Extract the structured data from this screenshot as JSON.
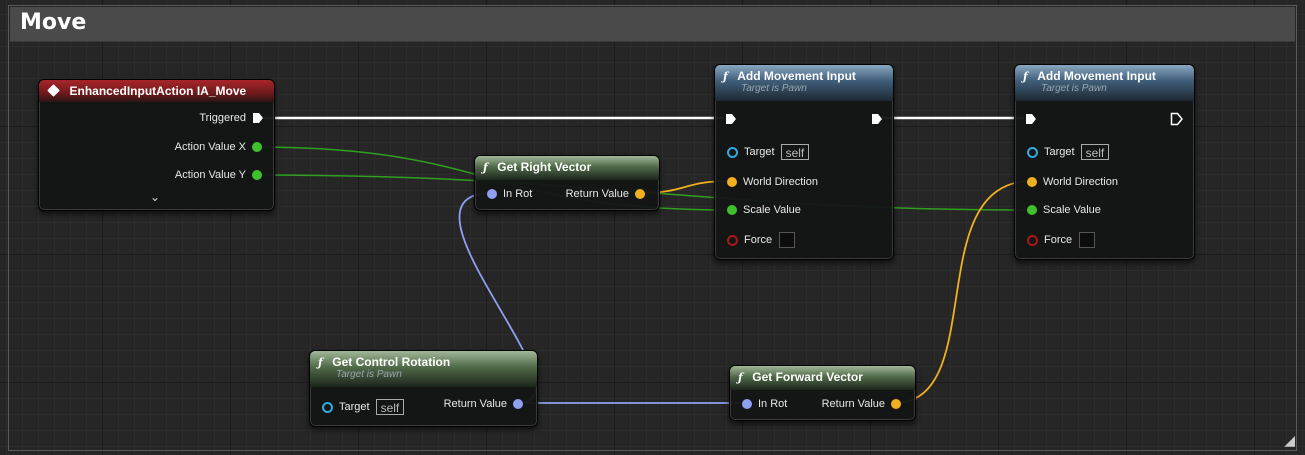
{
  "comment": {
    "title": "Move"
  },
  "nodes": {
    "event": {
      "title": "EnhancedInputAction IA_Move",
      "pins": {
        "triggered": "Triggered",
        "action_x": "Action Value X",
        "action_y": "Action Value Y"
      },
      "expand_icon": "chevron-down-icon"
    },
    "right_vector": {
      "title": "Get Right Vector",
      "pins": {
        "in_rot": "In Rot",
        "return": "Return Value"
      }
    },
    "control_rotation": {
      "title": "Get Control Rotation",
      "subtitle": "Target is Pawn",
      "pins": {
        "target": "Target",
        "target_value": "self",
        "return": "Return Value"
      }
    },
    "forward_vector": {
      "title": "Get Forward Vector",
      "pins": {
        "in_rot": "In Rot",
        "return": "Return Value"
      }
    },
    "add_movement_1": {
      "title": "Add Movement Input",
      "subtitle": "Target is Pawn",
      "pins": {
        "target": "Target",
        "target_value": "self",
        "world_direction": "World Direction",
        "scale_value": "Scale Value",
        "force": "Force"
      }
    },
    "add_movement_2": {
      "title": "Add Movement Input",
      "subtitle": "Target is Pawn",
      "pins": {
        "target": "Target",
        "target_value": "self",
        "world_direction": "World Direction",
        "scale_value": "Scale Value",
        "force": "Force"
      }
    }
  },
  "colors": {
    "exec": "#ffffff",
    "float": "#3fc12e",
    "vector": "#f0b020",
    "rotator": "#8fa0f0",
    "object": "#30a8e0",
    "bool": "#a81818",
    "event_header": "#a8252a",
    "function_header": "#3f5d78",
    "pure_header": "#4f6a48"
  }
}
